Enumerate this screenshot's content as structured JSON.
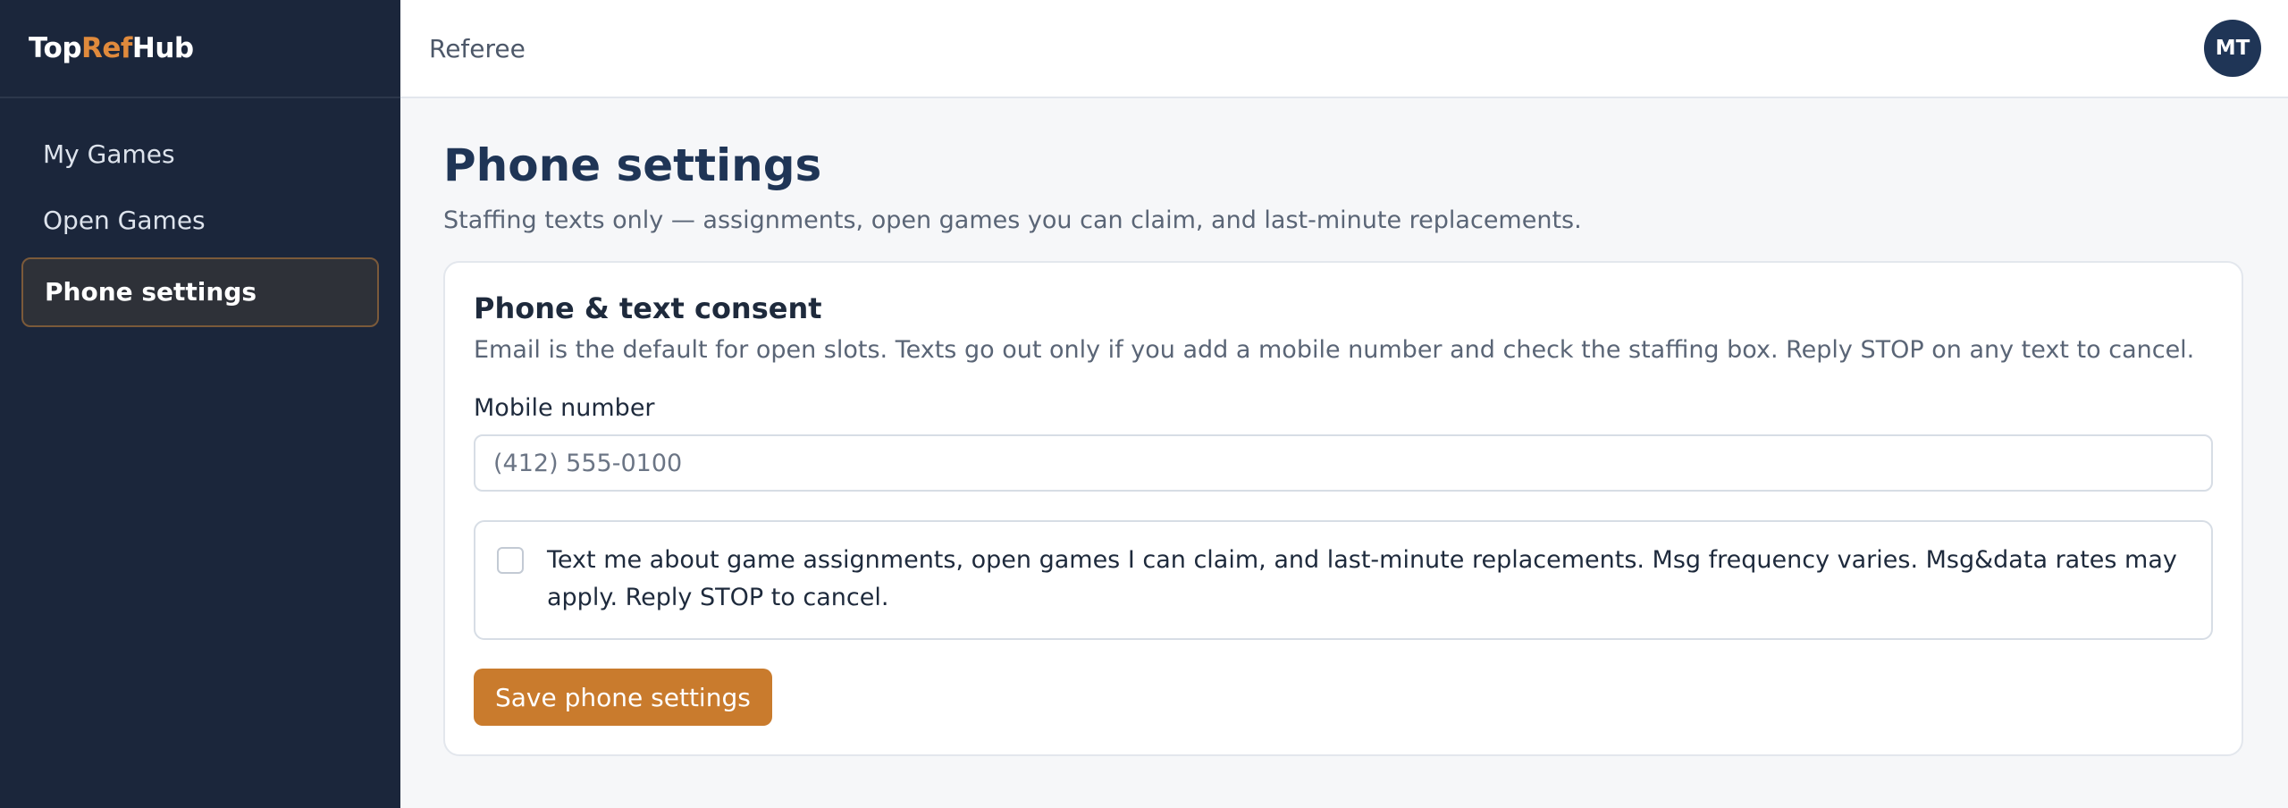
{
  "brand": {
    "part1": "Top",
    "part2": "Ref",
    "part3": "Hub",
    "accent_color": "#e08a3c"
  },
  "sidebar": {
    "items": [
      {
        "label": "My Games",
        "active": false
      },
      {
        "label": "Open Games",
        "active": false
      },
      {
        "label": "Phone settings",
        "active": true
      }
    ]
  },
  "topbar": {
    "title": "Referee",
    "avatar_initials": "MT"
  },
  "page": {
    "title": "Phone settings",
    "subtitle": "Staffing texts only — assignments, open games you can claim, and last-minute replacements."
  },
  "card": {
    "title": "Phone & text consent",
    "description": "Email is the default for open slots. Texts go out only if you add a mobile number and check the staffing box. Reply STOP on any text to cancel.",
    "mobile_label": "Mobile number",
    "mobile_value": "",
    "mobile_placeholder": "(412) 555-0100",
    "consent_checked": false,
    "consent_text": "Text me about game assignments, open games I can claim, and last-minute replacements. Msg frequency varies. Msg&data rates may apply. Reply STOP to cancel.",
    "save_label": "Save phone settings"
  },
  "colors": {
    "sidebar_bg": "#1b263b",
    "primary_button": "#c97b2d",
    "title": "#1f3556"
  }
}
